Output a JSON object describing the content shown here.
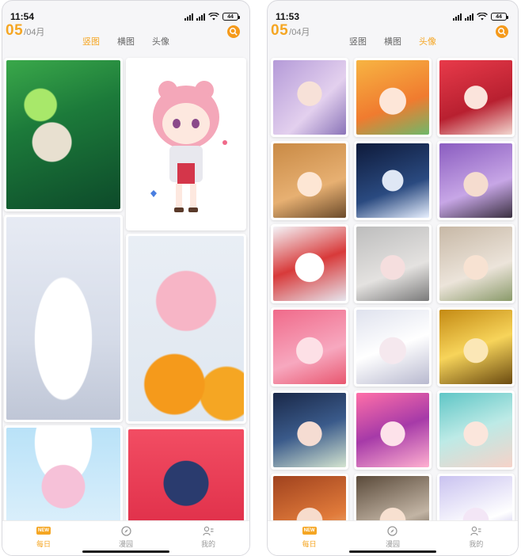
{
  "left_screen": {
    "status": {
      "time": "11:54",
      "battery": "44"
    },
    "date": {
      "day": "05",
      "month": "/04月"
    },
    "tabs": [
      {
        "label": "竖图",
        "active": true
      },
      {
        "label": "横图",
        "active": false
      },
      {
        "label": "头像",
        "active": false
      }
    ],
    "nav": [
      {
        "label": "每日",
        "icon": "new-badge-icon",
        "badge": "NEW",
        "active": true
      },
      {
        "label": "漫园",
        "icon": "compass-icon",
        "active": false
      },
      {
        "label": "我的",
        "icon": "profile-icon",
        "active": false
      }
    ],
    "wallpapers": [
      "forest-girl",
      "chibi-pink-twin-buns",
      "white-robe-fan-girl",
      "orange-box-girl",
      "white-hat-girl",
      "cat-ear-crown-boy"
    ]
  },
  "right_screen": {
    "status": {
      "time": "11:53",
      "battery": "44"
    },
    "date": {
      "day": "05",
      "month": "/04月"
    },
    "tabs": [
      {
        "label": "竖图",
        "active": false
      },
      {
        "label": "横图",
        "active": false
      },
      {
        "label": "头像",
        "active": true
      }
    ],
    "nav": [
      {
        "label": "每日",
        "icon": "new-badge-icon",
        "badge": "NEW",
        "active": true
      },
      {
        "label": "漫园",
        "icon": "compass-icon",
        "active": false
      },
      {
        "label": "我的",
        "icon": "profile-icon",
        "active": false
      }
    ],
    "avatars": 18
  },
  "colors": {
    "accent": "#f5a623",
    "inactive": "#9a9a9a",
    "background": "#f6f6f8"
  }
}
